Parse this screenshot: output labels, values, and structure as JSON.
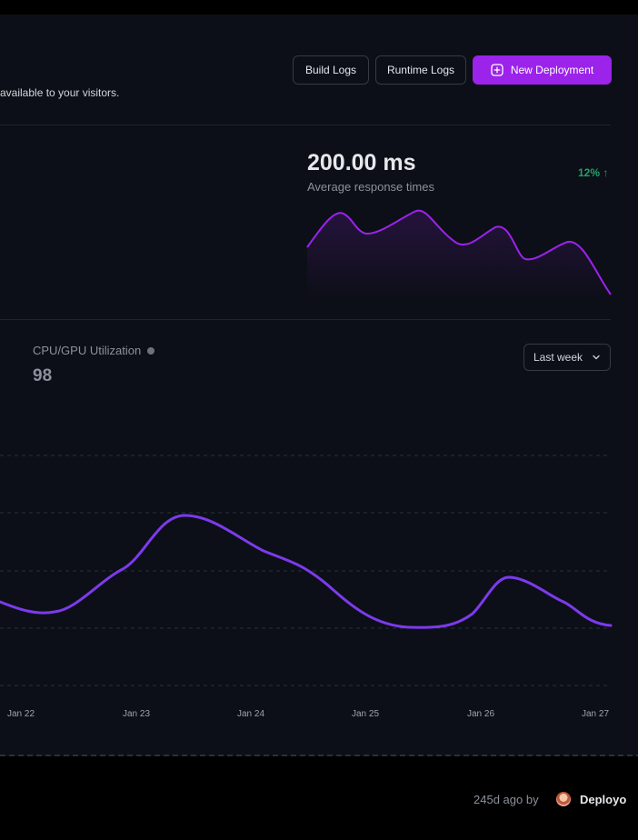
{
  "header": {
    "subtitle": "available to your visitors.",
    "buttons": {
      "build_logs": "Build Logs",
      "runtime_logs": "Runtime Logs",
      "new_deployment": "New Deployment"
    }
  },
  "response_metric": {
    "value": "200.00 ms",
    "label": "Average response times",
    "delta": "12% ↑",
    "delta_color": "#22a06b",
    "line_color": "#9b23ea"
  },
  "cpu_metric": {
    "label": "CPU/GPU Utilization",
    "value": "98",
    "range_select": "Last week"
  },
  "chart_data": {
    "type": "line",
    "x": [
      "Jan 22",
      "Jan 23",
      "Jan 24",
      "Jan 25",
      "Jan 26",
      "Jan 27"
    ],
    "y": [
      30,
      48,
      70,
      42,
      30,
      47,
      30
    ],
    "grid": true,
    "line_color": "#7c3aed"
  },
  "footer": {
    "time": "245d ago by",
    "user": "Deployo"
  },
  "colors": {
    "accent": "#9b23ea",
    "background": "#0c0f17"
  }
}
